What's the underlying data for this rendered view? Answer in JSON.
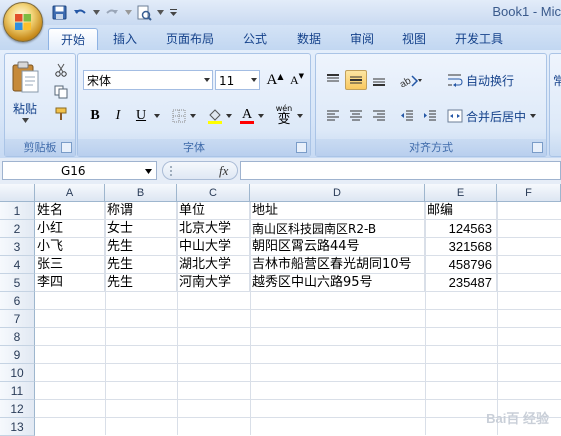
{
  "window": {
    "title": "Book1 - Mic"
  },
  "tabs": [
    "开始",
    "插入",
    "页面布局",
    "公式",
    "数据",
    "审阅",
    "视图",
    "开发工具"
  ],
  "ribbon": {
    "clipboard": {
      "paste_label": "粘贴",
      "group_label": "剪贴板"
    },
    "font": {
      "font_name": "宋体",
      "font_size": "11",
      "bold": "B",
      "italic": "I",
      "underline": "U",
      "font_color_letter": "A",
      "phonetic": "wén",
      "phonetic_char": "变",
      "group_label": "字体",
      "grow": "A",
      "shrink": "A"
    },
    "alignment": {
      "wrap_text": "自动换行",
      "merge_center": "合并后居中",
      "group_label": "对齐方式"
    },
    "number": {
      "format_partial": "常"
    }
  },
  "formula_bar": {
    "name_box": "G16",
    "fx": "fx",
    "formula": ""
  },
  "grid": {
    "columns": [
      "A",
      "B",
      "C",
      "D",
      "E",
      "F"
    ],
    "row_numbers": [
      "1",
      "2",
      "3",
      "4",
      "5",
      "6",
      "7",
      "8",
      "9",
      "10",
      "11",
      "12",
      "13"
    ],
    "rows": [
      [
        "姓名",
        "称谓",
        "单位",
        "地址",
        "邮编"
      ],
      [
        "小红",
        "女士",
        "北京大学",
        "南山区科技园南区R2-B",
        "124563"
      ],
      [
        "小飞",
        "先生",
        "中山大学",
        "朝阳区霄云路44号",
        "321568"
      ],
      [
        "张三",
        "先生",
        "湖北大学",
        "吉林市船营区春光胡同10号",
        "458796"
      ],
      [
        "李四",
        "先生",
        "河南大学",
        "越秀区中山六路95号",
        "235487"
      ]
    ]
  },
  "watermark": "Bai百 经验"
}
